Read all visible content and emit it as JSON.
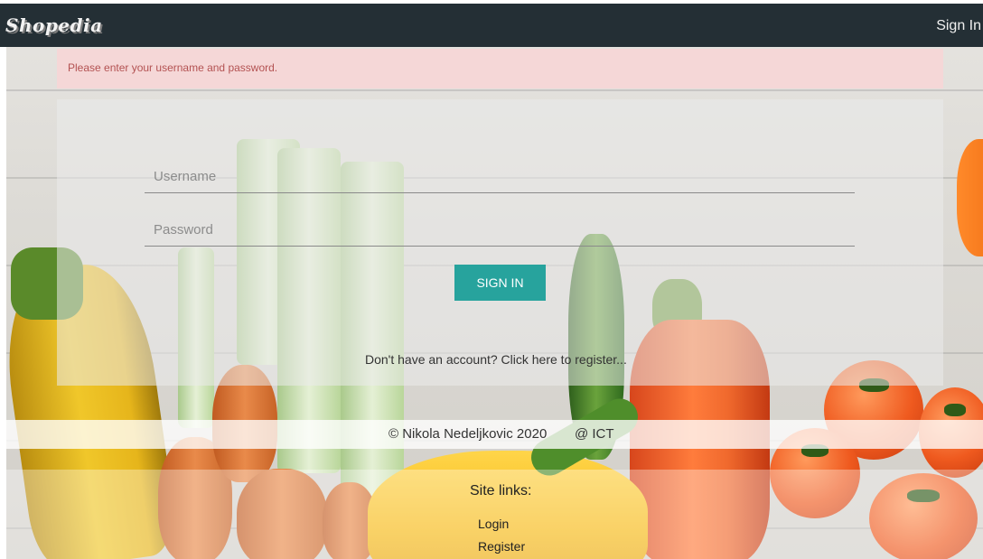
{
  "navbar": {
    "brand": "Shopedia",
    "signin_link": "Sign In"
  },
  "alert": {
    "message": "Please enter your username and password."
  },
  "form": {
    "username_placeholder": "Username",
    "username_value": "",
    "password_placeholder": "Password",
    "password_value": "",
    "submit_label": "SIGN IN",
    "register_prompt": "Don't have an account? Click here to register..."
  },
  "footer": {
    "copyright": "© Nikola Nedeljkovic 2020",
    "org": "@ ICT",
    "site_links_heading": "Site links:",
    "links": [
      "Login",
      "Register"
    ]
  },
  "colors": {
    "navbar": "#242f35",
    "accent": "#27a39d",
    "alert_bg": "#f6d6d6",
    "alert_text": "#b35252"
  }
}
